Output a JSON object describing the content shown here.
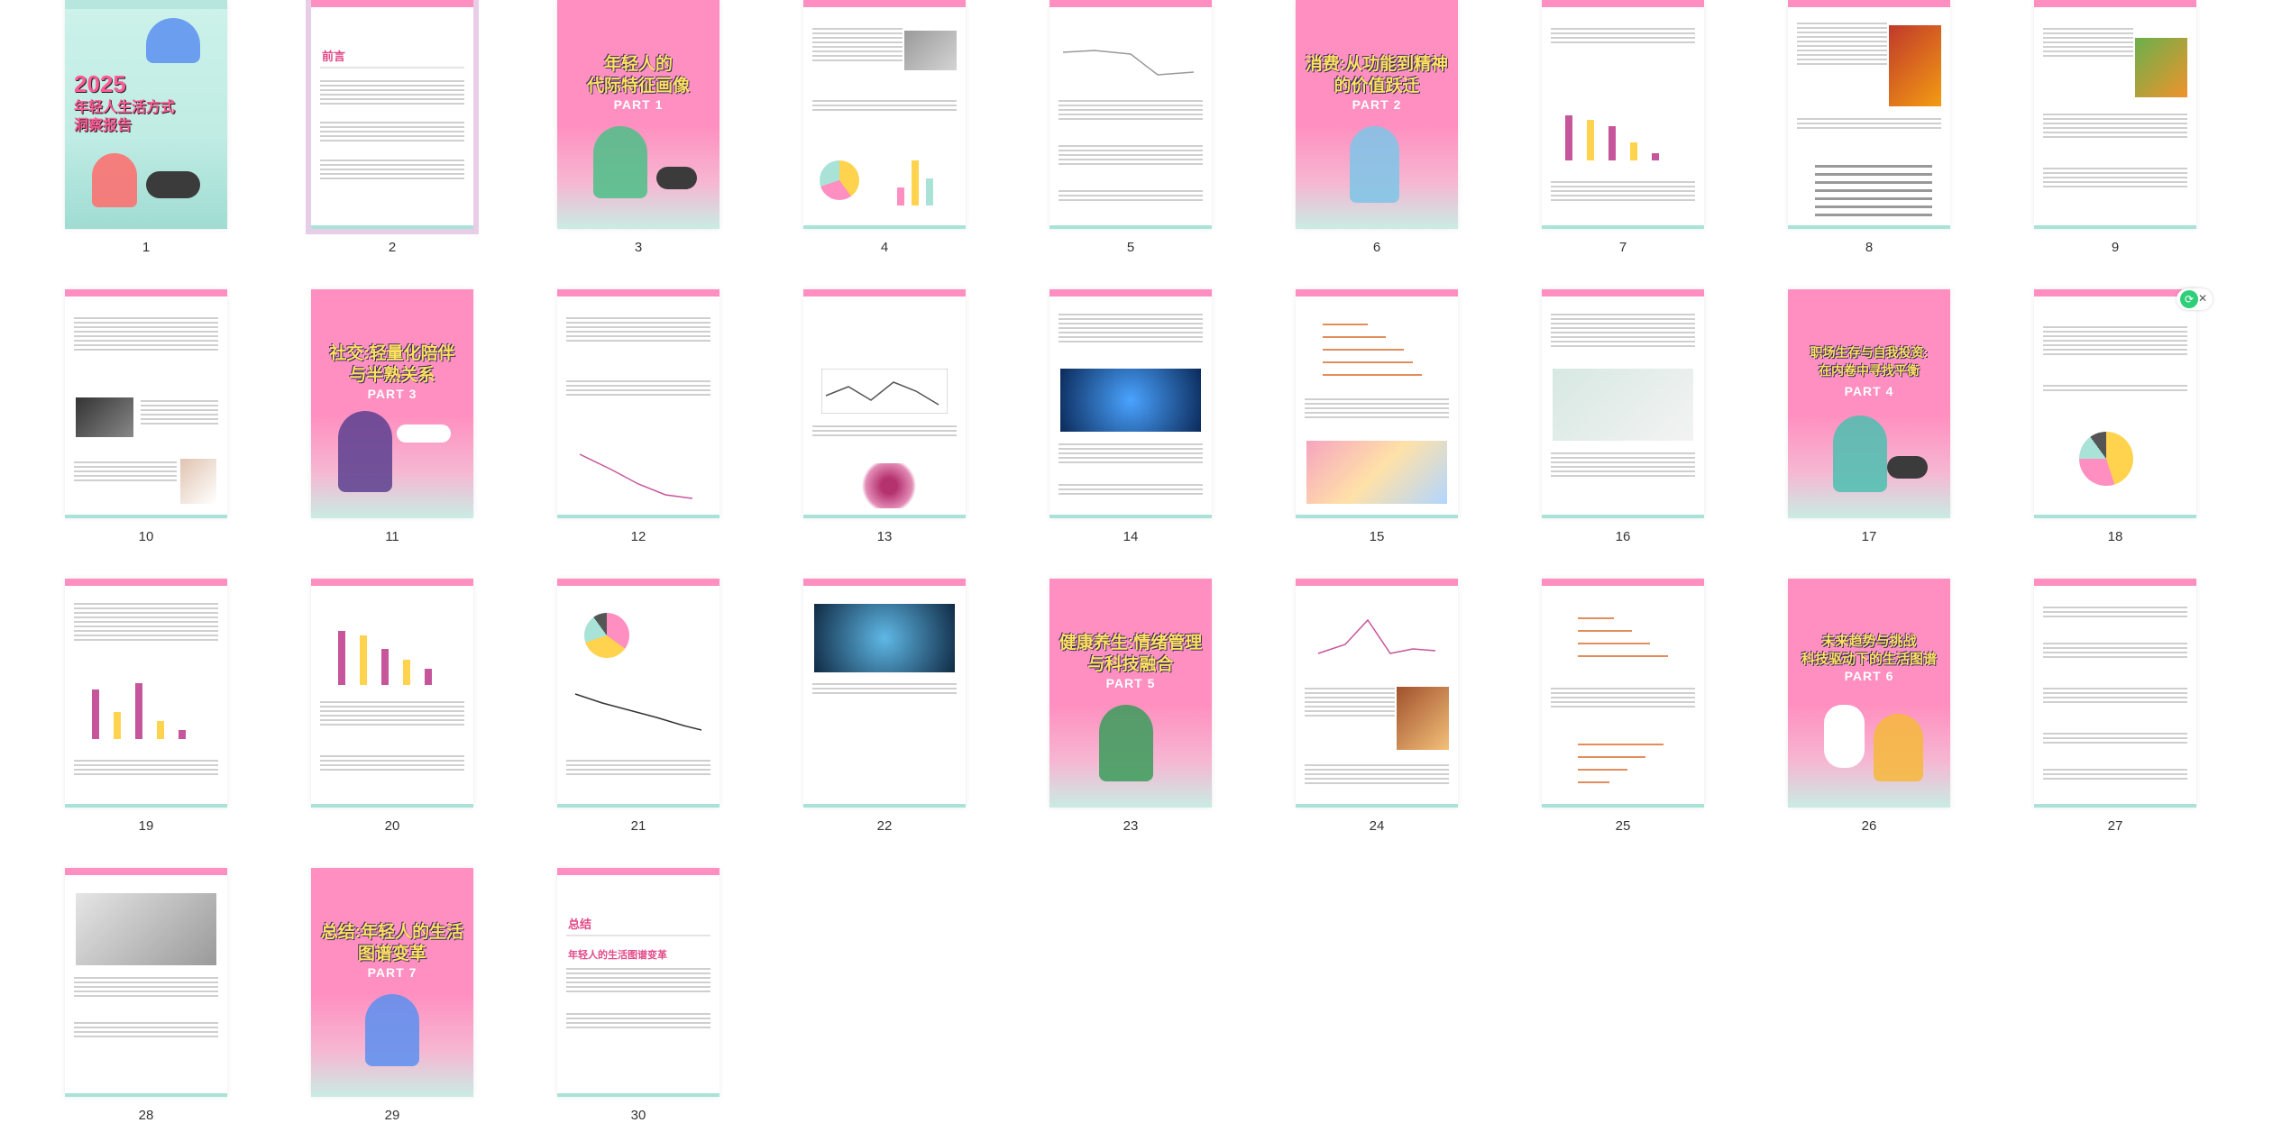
{
  "document": {
    "cover": {
      "year": "2025",
      "title_line": "年轻人生活方式",
      "title_line2": "洞察报告"
    },
    "preface_heading": "前言",
    "summary": {
      "heading": "总结",
      "subheading": "年轻人的生活图谱变革"
    },
    "parts": [
      {
        "page": 3,
        "title": "年轻人的\n代际特征画像",
        "label": "PART 1"
      },
      {
        "page": 6,
        "title": "消费:从功能到精神\n的价值跃迁",
        "label": "PART 2"
      },
      {
        "page": 11,
        "title": "社交:轻量化陪伴\n与半熟关系",
        "label": "PART 3"
      },
      {
        "page": 17,
        "title": "职场生存与自我投资:\n在内卷中寻找平衡",
        "label": "PART 4"
      },
      {
        "page": 23,
        "title": "健康养生:情绪管理\n与科技融合",
        "label": "PART 5"
      },
      {
        "page": 26,
        "title": "未来趋势与挑战\n科技驱动下的生活图谱",
        "label": "PART 6"
      },
      {
        "page": 29,
        "title": "总结:年轻人的生活\n图谱变革",
        "label": "PART 7"
      }
    ]
  },
  "thumbnails": [
    {
      "n": "1"
    },
    {
      "n": "2"
    },
    {
      "n": "3"
    },
    {
      "n": "4"
    },
    {
      "n": "5"
    },
    {
      "n": "6"
    },
    {
      "n": "7"
    },
    {
      "n": "8"
    },
    {
      "n": "9"
    },
    {
      "n": "10"
    },
    {
      "n": "11"
    },
    {
      "n": "12"
    },
    {
      "n": "13"
    },
    {
      "n": "14"
    },
    {
      "n": "15"
    },
    {
      "n": "16"
    },
    {
      "n": "17"
    },
    {
      "n": "18"
    },
    {
      "n": "19"
    },
    {
      "n": "20"
    },
    {
      "n": "21"
    },
    {
      "n": "22"
    },
    {
      "n": "23"
    },
    {
      "n": "24"
    },
    {
      "n": "25"
    },
    {
      "n": "26"
    },
    {
      "n": "27"
    },
    {
      "n": "28"
    },
    {
      "n": "29"
    },
    {
      "n": "30"
    }
  ],
  "selected_page": "2",
  "colors": {
    "accent_pink": "#ff8fc0",
    "accent_mint": "#a9e3d8",
    "title_yellow": "#ffe25c",
    "selection": "#e7cde6"
  },
  "icons": {
    "share": "share-icon",
    "close": "close-icon"
  }
}
